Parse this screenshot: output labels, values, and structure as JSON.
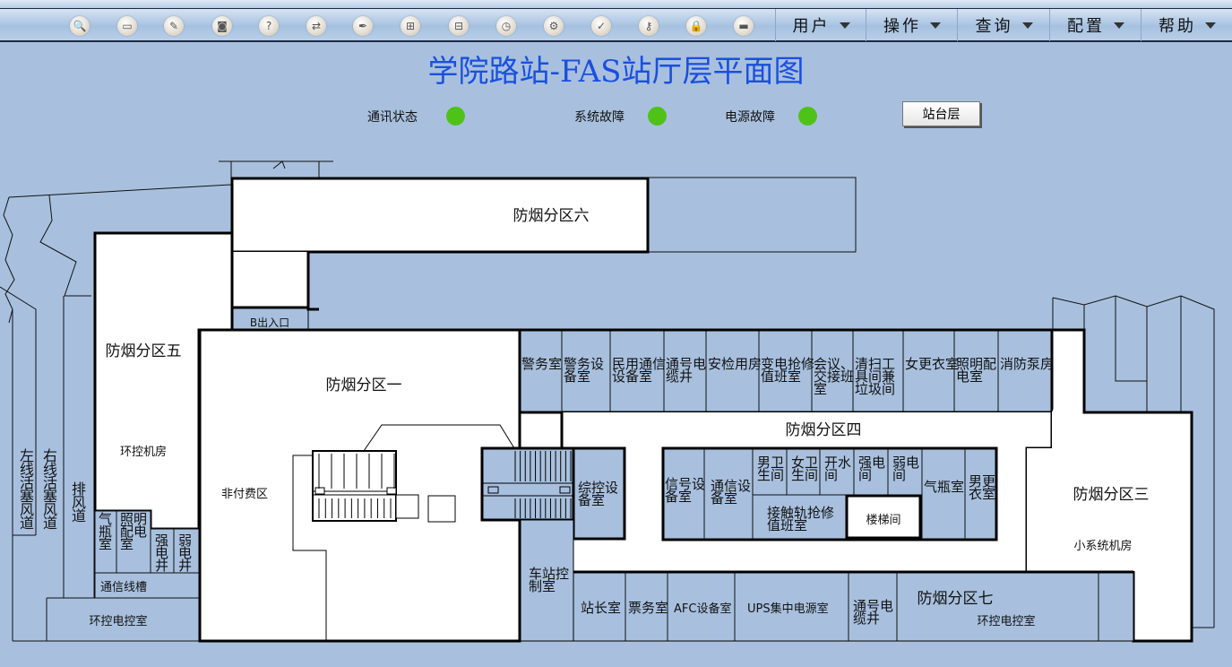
{
  "toolbar": {
    "tools": [
      {
        "icon": "search-icon",
        "glyph": "🔍"
      },
      {
        "icon": "fullscreen-icon",
        "glyph": "▭"
      },
      {
        "icon": "edit-icon",
        "glyph": "✎"
      },
      {
        "icon": "camera-icon",
        "glyph": "◙"
      },
      {
        "icon": "help-icon",
        "glyph": "?"
      },
      {
        "icon": "switch-icon",
        "glyph": "⇄"
      },
      {
        "icon": "pin-icon",
        "glyph": "✒"
      },
      {
        "icon": "network-icon",
        "glyph": "⊞"
      },
      {
        "icon": "device-icon",
        "glyph": "⊟"
      },
      {
        "icon": "history-icon",
        "glyph": "◷"
      },
      {
        "icon": "settings-icon",
        "glyph": "⚙"
      },
      {
        "icon": "tools-icon",
        "glyph": "✓"
      },
      {
        "icon": "key-icon",
        "glyph": "⚷"
      },
      {
        "icon": "lock-icon",
        "glyph": "🔒"
      },
      {
        "icon": "server-icon",
        "glyph": "▬"
      }
    ],
    "menus": [
      "用户",
      "操作",
      "查询",
      "配置",
      "帮助"
    ]
  },
  "title": "学院路站-FAS站厅层平面图",
  "status": [
    {
      "label": "通讯状态",
      "state": "normal",
      "color": "#4fc21a"
    },
    {
      "label": "系统故障",
      "state": "normal",
      "color": "#4fc21a"
    },
    {
      "label": "电源故障",
      "state": "normal",
      "color": "#4fc21a"
    }
  ],
  "nav_button": "站台层",
  "plan": {
    "zones": {
      "z1": "防烟分区一",
      "z3": "防烟分区三",
      "z4": "防烟分区四",
      "z5": "防烟分区五",
      "z6": "防烟分区六",
      "z7": "防烟分区七"
    },
    "exit_b": "B出入口",
    "left": {
      "zuoxian": "左线活塞风道",
      "youxian": "右线活塞风道",
      "paifeng": "排风道",
      "huankong_jifang": "环控机房",
      "qiping": "气瓶室",
      "zhaoming": "照明配电室",
      "qiangdian": "强电井",
      "ruodian": "弱电井",
      "tongxin_xiancao": "通信线槽",
      "huankong_dian": "环控电控室"
    },
    "z1": {
      "feifu": "非付费区",
      "chezhan": "车站控制室",
      "zongkong": "综控设备室"
    },
    "north_rooms": [
      "警务室",
      "警务设备室",
      "民用通信设备室",
      "通号电缆井",
      "安检用房",
      "变电抢修值班室",
      "会议、交接班室",
      "清扫工具间兼垃圾间",
      "女更衣室",
      "照明配电室",
      "消防泵房"
    ],
    "inner": {
      "xinhao": "信号设备室",
      "tongxin": "通信设备室",
      "nanwei": "男卫生间",
      "nvwei": "女卫生间",
      "kaishui": "开水间",
      "qiangdian": "强电间",
      "ruodian": "弱电间",
      "qiping": "气瓶室",
      "nangeng": "男更衣室",
      "jiechu": "接触轨抢修值班室",
      "louti": "楼梯间"
    },
    "south_rooms": [
      "站长室",
      "票务室",
      "AFC设备室",
      "UPS集中电源室",
      "通号电缆井"
    ],
    "z7_room": "环控电控室",
    "z3_room": "小系统机房"
  }
}
